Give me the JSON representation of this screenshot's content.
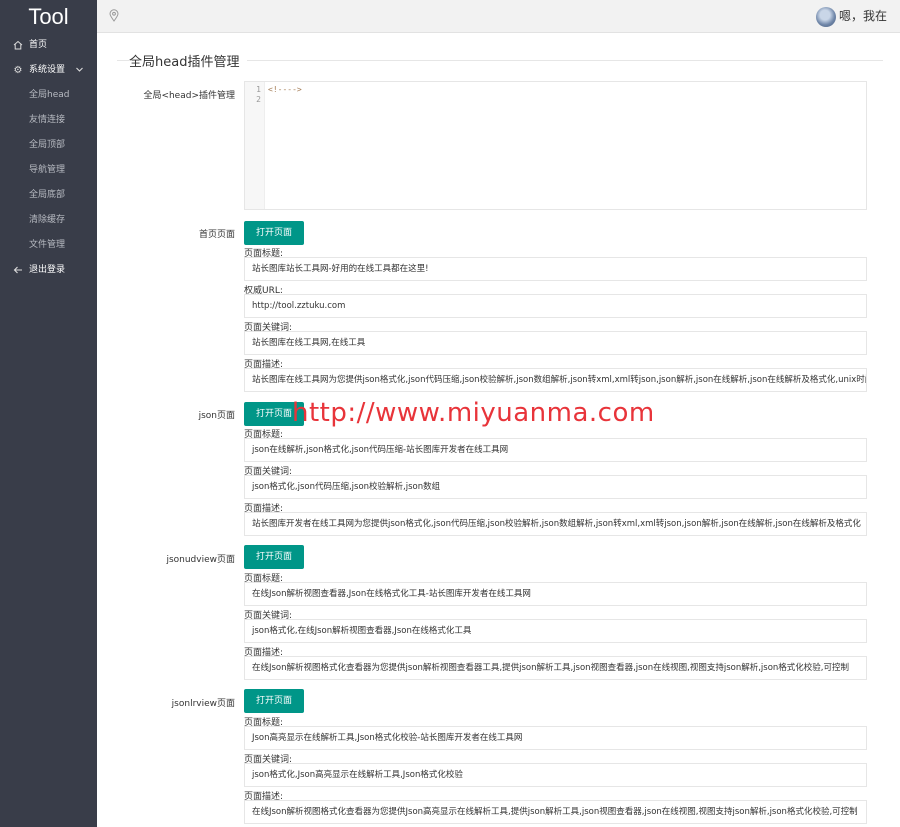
{
  "app": {
    "logo": "Tool"
  },
  "header": {
    "user_text": "嗯，我在"
  },
  "sidebar": {
    "home": "首页",
    "settings": "系统设置",
    "sub_items": [
      "全局head",
      "友情连接",
      "全局顶部",
      "导航管理",
      "全局底部",
      "清除缓存",
      "文件管理"
    ],
    "logout": "退出登录"
  },
  "page": {
    "title": "全局head插件管理"
  },
  "head_plugin": {
    "label": "全局<head>插件管理",
    "line_numbers": [
      "1",
      "2"
    ],
    "code": "<!---->"
  },
  "open_button_label": "打开页面",
  "field_labels": {
    "title": "页面标题:",
    "url": "权威URL:",
    "keywords": "页面关键词:",
    "description": "页面描述:"
  },
  "pages": [
    {
      "name": "首页页面",
      "title": "站长图库站长工具网-好用的在线工具都在这里!",
      "url": "http://tool.zztuku.com",
      "keywords": "站长图库在线工具网,在线工具",
      "description": "站长图库在线工具网为您提供json格式化,json代码压缩,json校验解析,json数组解析,json转xml,xml转json,json解析,json在线解析,json在线解析及格式化,unix时间戳"
    },
    {
      "name": "json页面",
      "title": "json在线解析,json格式化,json代码压缩-站长图库开发者在线工具网",
      "keywords": "json格式化,json代码压缩,json校验解析,json数组",
      "description": "站长图库开发者在线工具网为您提供json格式化,json代码压缩,json校验解析,json数组解析,json转xml,xml转json,json解析,json在线解析,json在线解析及格式化"
    },
    {
      "name": "jsonudview页面",
      "title": "在线Json解析视图查看器,Json在线格式化工具-站长图库开发者在线工具网",
      "keywords": "json格式化,在线Json解析视图查看器,Json在线格式化工具",
      "description": "在线Json解析视图格式化查看器为您提供json解析视图查看器工具,提供json解析工具,json视图查看器,json在线视图,视图支持json解析,json格式化校验,可控制"
    },
    {
      "name": "jsonlrview页面",
      "title": "Json高亮显示在线解析工具,Json格式化校验-站长图库开发者在线工具网",
      "keywords": "json格式化,Json高亮显示在线解析工具,Json格式化校验",
      "description": "在线Json解析视图格式化查看器为您提供Json高亮显示在线解析工具,提供json解析工具,json视图查看器,json在线视图,视图支持json解析,json格式化校验,可控制"
    }
  ],
  "watermark": "http://www.miyuanma.com",
  "colors": {
    "sidebar_bg": "#393d49",
    "button": "#009688",
    "watermark": "#e8343a"
  }
}
